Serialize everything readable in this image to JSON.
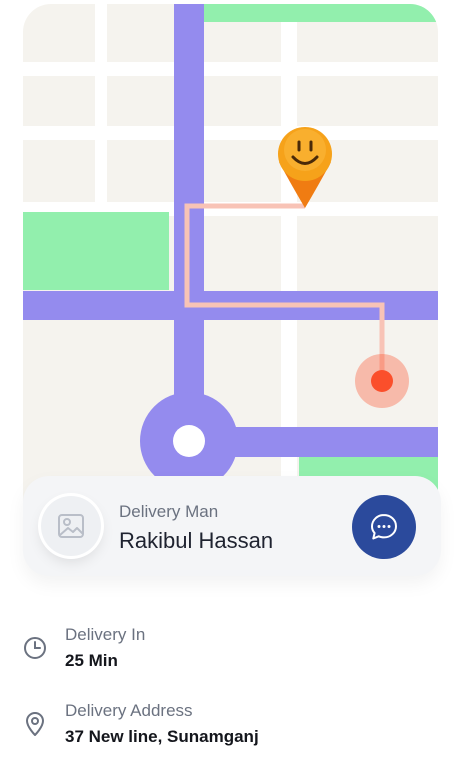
{
  "map": {
    "destination_pin_icon": "smiley-pin-icon",
    "current_location_icon": "current-location-dot-icon",
    "roundabout_icon": "roundabout-marker-icon"
  },
  "driver": {
    "role": "Delivery Man",
    "name": "Rakibul Hassan",
    "avatar_icon": "image-placeholder-icon",
    "chat_icon": "chat-bubble-icon"
  },
  "delivery_time": {
    "label": "Delivery In",
    "value": "25 Min",
    "icon": "clock-icon"
  },
  "delivery_address": {
    "label": "Delivery Address",
    "value": "37 New line, Sunamganj",
    "icon": "location-pin-icon"
  },
  "colors": {
    "road": "#948bee",
    "park": "#92efad",
    "route": "#f8c3b6",
    "pin": "#f6a21a",
    "current_location": "#fb4f2b",
    "chat_button": "#2b4a9c"
  }
}
